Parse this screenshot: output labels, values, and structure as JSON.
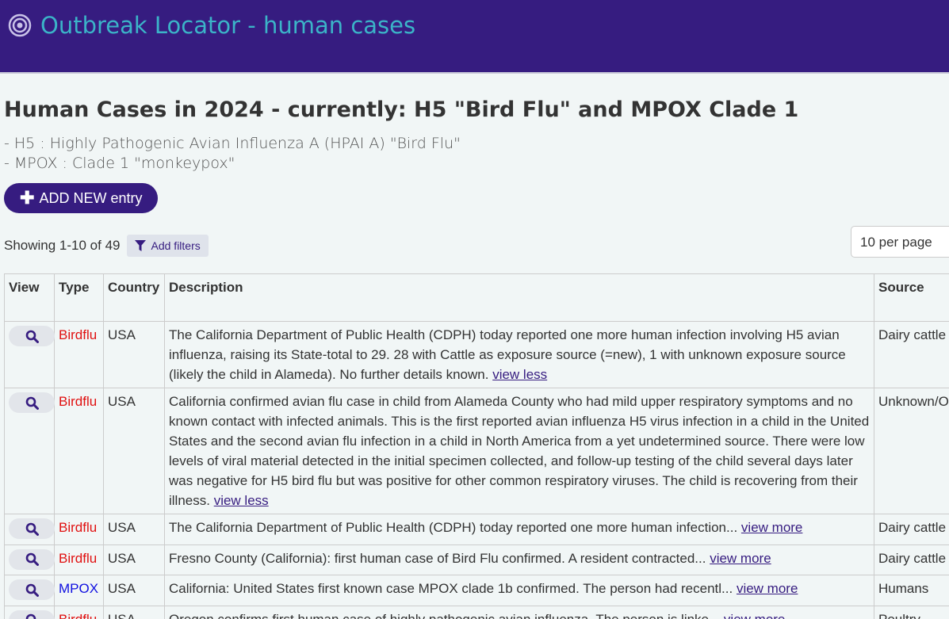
{
  "header": {
    "brand_title": "Outbreak Locator - human cases"
  },
  "page": {
    "title": "Human Cases in 2024 - currently: H5 \"Bird Flu\" and MPOX Clade 1",
    "sub_lines": [
      "- H5 : Highly Pathogenic Avian Influenza A (HPAI A) \"Bird Flu\"",
      "- MPOX : Clade 1 \"monkeypox\""
    ],
    "add_button_label": "ADD NEW entry"
  },
  "controls": {
    "showing": "Showing 1-10 of 49",
    "filters_label": "Add filters",
    "per_page": "10 per page"
  },
  "table": {
    "headers": [
      "View",
      "Type",
      "Country",
      "Description",
      "Source"
    ],
    "rows": [
      {
        "type": "Birdflu",
        "country": "USA",
        "description": "The California Department of Public Health (CDPH) today reported one more human infection involving H5 avian influenza, raising its State-total to 29. 28 with Cattle as exposure source (=new), 1 with unknown exposure source (likely the child in Alameda). No further details known.",
        "link": "view less",
        "source": "Dairy cattle"
      },
      {
        "type": "Birdflu",
        "country": "USA",
        "description": "California confirmed avian flu case in child from Alameda County who had mild upper respiratory symptoms and no known contact with infected animals. This is the first reported avian influenza H5 virus infection in a child in the United States and the second avian flu infection in a child in North America from a yet undetermined source. There were low levels of viral material detected in the initial specimen collected, and follow-up testing of the child several days later was negative for H5 bird flu but was positive for other common respiratory viruses. The child is recovering from their illness.",
        "link": "view less",
        "source": "Unknown/O"
      },
      {
        "type": "Birdflu",
        "country": "USA",
        "description": "The California Department of Public Health (CDPH) today reported one more human infection...",
        "link": "view more",
        "source": "Dairy cattle"
      },
      {
        "type": "Birdflu",
        "country": "USA",
        "description": "Fresno County (California): first human case of Bird Flu confirmed. A resident contracted...",
        "link": "view more",
        "source": "Dairy cattle"
      },
      {
        "type": "MPOX",
        "country": "USA",
        "description": "California: United States first known case MPOX clade 1b confirmed. The person had recentl...",
        "link": "view more",
        "source": "Humans"
      },
      {
        "type": "Birdflu",
        "country": "USA",
        "description": "Oregon confirms first human case of highly pathogenic avian influenza. The person is linke...",
        "link": "view more",
        "source": "Poultry"
      }
    ]
  },
  "colors": {
    "header_bg": "#361c80",
    "brand_text": "#3bb4c8",
    "birdflu": "#e01010",
    "mpox": "#1010e0"
  }
}
